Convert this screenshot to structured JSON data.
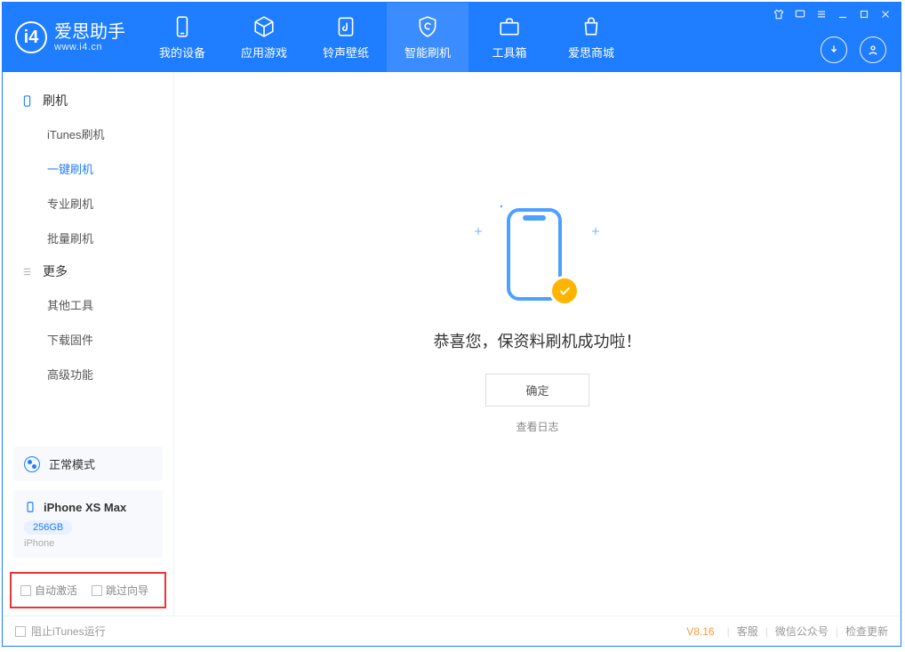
{
  "app": {
    "name": "爱思助手",
    "url": "www.i4.cn"
  },
  "nav": {
    "mydevice": "我的设备",
    "apps": "应用游戏",
    "ring": "铃声壁纸",
    "flash": "智能刷机",
    "tools": "工具箱",
    "store": "爱思商城"
  },
  "sidebar": {
    "section_flash": "刷机",
    "itunes_flash": "iTunes刷机",
    "one_click": "一键刷机",
    "pro_flash": "专业刷机",
    "batch_flash": "批量刷机",
    "section_more": "更多",
    "other_tools": "其他工具",
    "download_fw": "下载固件",
    "advanced": "高级功能"
  },
  "mode": {
    "label": "正常模式"
  },
  "device": {
    "name": "iPhone XS Max",
    "capacity": "256GB",
    "type": "iPhone"
  },
  "bottom_opts": {
    "auto_activate": "自动激活",
    "skip_guide": "跳过向导"
  },
  "main": {
    "message": "恭喜您，保资料刷机成功啦！",
    "ok": "确定",
    "view_log": "查看日志"
  },
  "footer": {
    "block_itunes": "阻止iTunes运行",
    "version": "V8.16",
    "support": "客服",
    "wechat": "微信公众号",
    "update": "检查更新"
  }
}
